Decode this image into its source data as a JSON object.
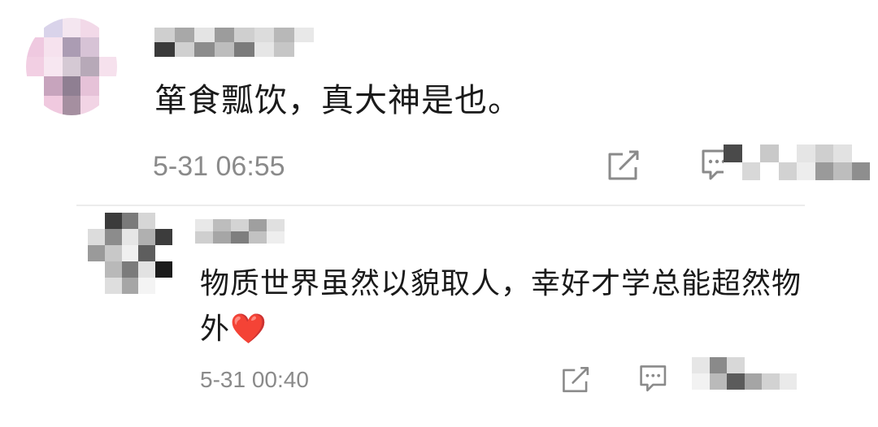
{
  "comments": [
    {
      "text": "箪食瓢饮，真大神是也。",
      "time": "5-31 06:55"
    },
    {
      "text": "物质世界虽然以貌取人，幸好才学总能超然物外",
      "emoji": "❤️",
      "time": "5-31 00:40"
    }
  ],
  "icons": {
    "share": "share-edit-icon",
    "reply": "comment-reply-icon"
  },
  "colors": {
    "text": "#1a1a1a",
    "meta": "#8a8a8a",
    "heart": "#e0242a",
    "divider": "#ececec"
  }
}
